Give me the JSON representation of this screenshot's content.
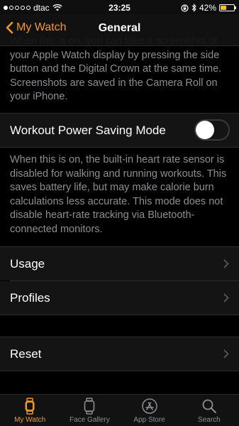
{
  "status_bar": {
    "carrier": "dtac",
    "time": "23:25",
    "battery_percent": "42%",
    "battery_level": 0.42,
    "battery_color": "#f0c419"
  },
  "nav": {
    "back_label": "My Watch",
    "title": "General",
    "accent_color": "#f09a1d"
  },
  "screenshot_note": "When this is on, you can take a screenshot of your Apple Watch display by pressing the side button and the Digital Crown at the same time. Screenshots are saved in the Camera Roll on your iPhone.",
  "workout_power_saving": {
    "label": "Workout Power Saving Mode",
    "enabled": false,
    "note": "When this is on, the built-in heart rate sensor is disabled for walking and running workouts. This saves battery life, but may make calorie burn calculations less accurate. This mode does not disable heart-rate tracking via Bluetooth-connected monitors."
  },
  "menu_items": [
    {
      "label": "Usage",
      "icon": "chevron-right-icon"
    },
    {
      "label": "Profiles",
      "icon": "chevron-right-icon"
    },
    {
      "label": "Reset",
      "icon": "chevron-right-icon"
    }
  ],
  "tabs": [
    {
      "label": "My Watch",
      "icon": "watch-icon",
      "active": true
    },
    {
      "label": "Face Gallery",
      "icon": "face-gallery-icon",
      "active": false
    },
    {
      "label": "App Store",
      "icon": "app-store-icon",
      "active": false
    },
    {
      "label": "Search",
      "icon": "search-icon",
      "active": false
    }
  ]
}
